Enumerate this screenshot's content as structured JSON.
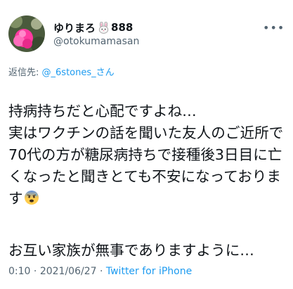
{
  "author": {
    "display_name": "ゆりまろ",
    "display_name_suffix": "888",
    "emoji_icon": "rabbit-face-icon",
    "handle": "@otokumamasan",
    "avatar_icon": "pink-flower-avatar"
  },
  "more_icon": "more-options-icon",
  "reply": {
    "prefix": "返信先:",
    "target": "@_6stones_さん"
  },
  "tweet": {
    "line1": "持病持ちだと心配ですよね…",
    "line2": "実はワクチンの話を聞いた友人のご近所で70代の方が糖尿病持ちで接種後3日目に亡くなったと聞きとても不安になっております",
    "emoji": "anxious-face-with-sweat-icon",
    "paragraph2": "お互い家族が無事でありますように…"
  },
  "meta": {
    "time": "0:10",
    "separator": "·",
    "date": "2021/06/27",
    "source": "Twitter for iPhone"
  },
  "colors": {
    "link": "#1d9bf0",
    "secondary_text": "#536471",
    "text": "#0f1419"
  }
}
